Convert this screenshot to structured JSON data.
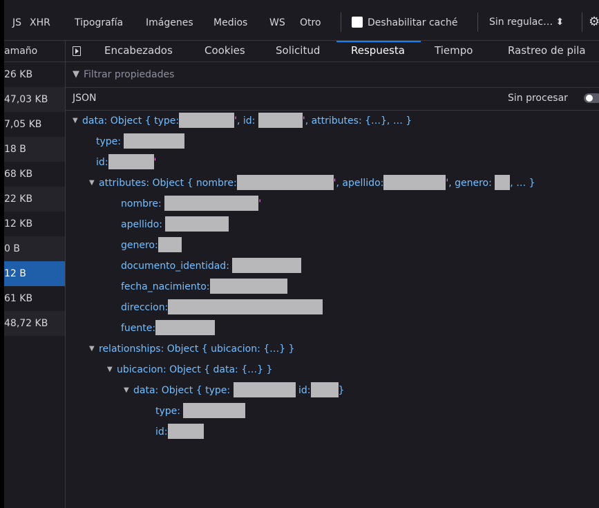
{
  "toolbar": {
    "filters": [
      "JS",
      "XHR",
      "Tipografía",
      "Imágenes",
      "Medios",
      "WS",
      "Otro"
    ],
    "disable_cache_label": "Deshabilitar caché",
    "throttle_label": "Sin regulac… ⬍"
  },
  "sizes": {
    "header": "amaño",
    "rows": [
      "26 KB",
      "47,03 KB",
      "7,05 KB",
      "18 B",
      "68 KB",
      "22 KB",
      "12 KB",
      "0 B",
      "12 B",
      "61 KB",
      "48,72 KB"
    ]
  },
  "tabs": [
    "Encabezados",
    "Cookies",
    "Solicitud",
    "Respuesta",
    "Tiempo",
    "Rastreo de pila"
  ],
  "filter_placeholder": "Filtrar propiedades",
  "json_label": "JSON",
  "raw_label": "Sin procesar",
  "tree": {
    "data_summary_a": "data: Object { type:",
    "data_summary_b": ", id:",
    "data_summary_c": ", attributes: {…}, … }",
    "type_key": "type:",
    "id_key": "id:",
    "attributes_summary_a": "attributes: Object { nombre:",
    "attributes_summary_b": ", apellido:",
    "attributes_summary_c": ", genero:",
    "attributes_summary_d": ", … }",
    "nombre_key": "nombre:",
    "apellido_key": "apellido:",
    "genero_key": "genero:",
    "documento_key": "documento_identidad:",
    "fecha_key": "fecha_nacimiento:",
    "direccion_key": "direccion:",
    "fuente_key": "fuente:",
    "relationships_summary": "relationships: Object { ubicacion: {…} }",
    "ubicacion_summary": "ubicacion: Object { data: {…} }",
    "inner_data_a": "data: Object { type:",
    "inner_data_b": "id:",
    "inner_data_c": "}",
    "inner_type_key": "type:",
    "inner_id_key": "id:"
  }
}
